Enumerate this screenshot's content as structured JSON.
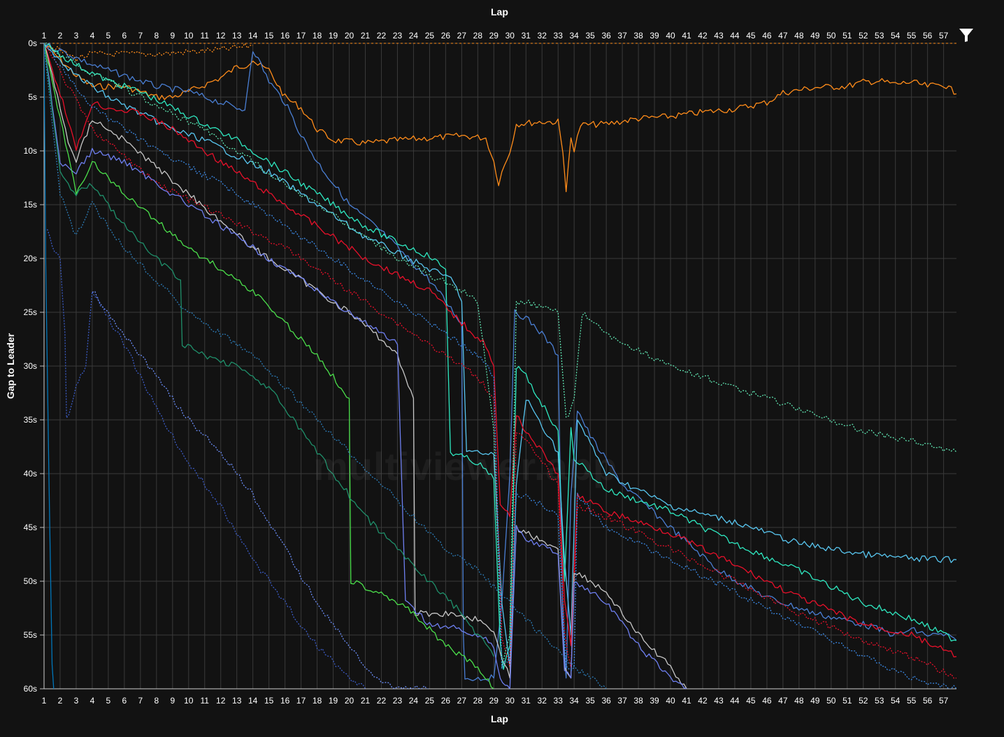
{
  "chart_data": {
    "type": "line",
    "xlabel": "Lap",
    "ylabel": "Gap to Leader",
    "x_ticks": [
      1,
      2,
      3,
      4,
      5,
      6,
      7,
      8,
      9,
      10,
      11,
      12,
      13,
      14,
      15,
      16,
      17,
      18,
      19,
      20,
      21,
      22,
      23,
      24,
      25,
      26,
      27,
      28,
      29,
      30,
      31,
      32,
      33,
      34,
      35,
      36,
      37,
      38,
      39,
      40,
      41,
      42,
      43,
      44,
      45,
      46,
      47,
      48,
      49,
      50,
      51,
      52,
      53,
      54,
      55,
      56,
      57
    ],
    "y_ticks": [
      "0s",
      "5s",
      "10s",
      "15s",
      "20s",
      "25s",
      "30s",
      "35s",
      "40s",
      "45s",
      "50s",
      "55s",
      "60s"
    ],
    "xlim": [
      1,
      57.8
    ],
    "ylim": [
      0,
      60
    ],
    "y_inverted": true,
    "grid": true,
    "watermark": "multiviewer.app",
    "series": [
      {
        "color": "#ff8c1a",
        "dashed": false,
        "x": [
          1,
          2,
          3,
          4,
          6,
          8,
          9,
          10,
          12,
          13,
          13.6,
          14,
          14.3,
          15,
          16,
          17,
          18,
          19,
          21,
          23,
          25,
          27,
          28.5,
          29,
          29.3,
          29.5,
          30,
          30.4,
          32,
          33,
          33.3,
          33.5,
          33.8,
          34,
          34.4,
          36,
          38,
          40,
          42,
          44,
          46,
          47,
          49,
          51,
          52,
          53,
          54,
          55,
          56,
          57,
          57.8
        ],
        "y": [
          0,
          1.5,
          3,
          4,
          4,
          5,
          5,
          4.5,
          3.2,
          2.2,
          2,
          1.5,
          2,
          2.5,
          5,
          6,
          8,
          9,
          9.3,
          9,
          8.8,
          8.6,
          8.8,
          11,
          13,
          12,
          10,
          7.5,
          7.3,
          7.3,
          10.2,
          13.8,
          8.5,
          10,
          7.6,
          7.5,
          7,
          6.8,
          6.4,
          6.1,
          5.5,
          4.6,
          4.1,
          4,
          3.6,
          3.5,
          3.8,
          3.6,
          4,
          3.8,
          4.7
        ]
      },
      {
        "color": "#ff8c1a",
        "dashed": true,
        "x": [
          1,
          3,
          4,
          6,
          8,
          10,
          12,
          14
        ],
        "y": [
          0,
          1.4,
          1,
          1,
          1,
          0.8,
          0.6,
          0.2
        ]
      },
      {
        "color": "#4a7fd4",
        "dashed": false,
        "x": [
          1,
          4,
          6,
          8,
          10,
          12,
          13.5,
          14,
          15,
          16,
          17,
          18,
          19,
          20,
          22,
          24,
          25,
          26,
          26.5,
          27,
          27.1,
          27.2,
          29,
          29.5,
          30,
          30.3,
          31,
          32,
          33,
          33.3,
          33.5,
          33.8,
          34.2,
          35,
          37,
          40,
          43,
          46,
          49,
          52,
          54,
          55,
          56,
          57,
          57.8
        ],
        "y": [
          0,
          2,
          3,
          4,
          4.5,
          5.5,
          6.2,
          0.5,
          3.5,
          5.5,
          8.5,
          11,
          13,
          15,
          17.5,
          20.5,
          22,
          24,
          25,
          26,
          55,
          59,
          59,
          52,
          40,
          25,
          25.5,
          27,
          29,
          54,
          59,
          42,
          34,
          36.5,
          41,
          45,
          49,
          51.5,
          53,
          54,
          55,
          54.5,
          55,
          55,
          55.5
        ]
      },
      {
        "color": "#2ee8c0",
        "dashed": false,
        "x": [
          1,
          3,
          5,
          7,
          9,
          11,
          13,
          15,
          17,
          19,
          21,
          23,
          25,
          26,
          26.3,
          28,
          29,
          29.4,
          29.6,
          30,
          30.4,
          31,
          33,
          33.4,
          33.8,
          34,
          36,
          40,
          44,
          48,
          52,
          55,
          57.8
        ],
        "y": [
          0,
          2,
          3.5,
          4.5,
          6,
          7.5,
          9,
          11,
          13,
          15,
          17,
          18.5,
          19.8,
          21,
          38,
          39,
          40.5,
          56,
          58,
          56,
          30,
          31,
          36,
          50,
          36,
          38.5,
          41.5,
          43.5,
          46.5,
          49,
          52,
          53.5,
          55.5
        ]
      },
      {
        "color": "#58c6f0",
        "dashed": false,
        "x": [
          1,
          3,
          5,
          7,
          9,
          11,
          13,
          15,
          17,
          19,
          21,
          23,
          25,
          26.5,
          27,
          27.3,
          29,
          29.5,
          30,
          30.4,
          31,
          33,
          33.4,
          33.8,
          34.2,
          36,
          40,
          44,
          48,
          52,
          55,
          57.8
        ],
        "y": [
          0,
          3,
          5,
          6.5,
          8,
          9,
          10.5,
          12,
          14,
          16,
          18,
          19.5,
          21,
          22,
          24,
          38,
          38.2,
          52,
          58,
          41,
          33,
          38,
          48,
          55,
          35,
          40,
          43,
          44.5,
          46.5,
          47.5,
          47.9,
          48
        ]
      },
      {
        "color": "#e8102a",
        "dashed": false,
        "x": [
          1,
          2.5,
          3,
          4,
          5,
          7,
          9,
          11,
          13,
          15,
          17,
          19,
          21,
          23,
          25,
          27,
          28.5,
          29,
          29.4,
          30,
          30.4,
          31,
          33,
          33.4,
          33.8,
          34.2,
          36,
          40,
          44,
          48,
          52,
          55,
          57.8
        ],
        "y": [
          0,
          7,
          10,
          5.5,
          6,
          6.5,
          8,
          10,
          12,
          14,
          16,
          18,
          20,
          21.5,
          23,
          26,
          28,
          30,
          43,
          44,
          34.5,
          36,
          40,
          52,
          56,
          42,
          43.5,
          45.5,
          48.5,
          51.5,
          54,
          55,
          57
        ]
      },
      {
        "color": "#e8102a",
        "dashed": true,
        "x": [
          1,
          4,
          8,
          12,
          16,
          20,
          24,
          28,
          29,
          29.5,
          30,
          30.4,
          31,
          33,
          33.4,
          33.8,
          34.2,
          36,
          40,
          44,
          48,
          52,
          55,
          57.8
        ],
        "y": [
          0,
          8,
          13,
          16,
          19,
          23,
          27,
          31,
          33,
          55,
          58,
          36,
          37,
          41,
          55,
          58,
          43,
          44,
          47,
          50,
          53,
          55.5,
          57,
          59
        ]
      },
      {
        "color": "#c8c8c8",
        "dashed": false,
        "x": [
          1,
          2.5,
          3,
          4,
          6,
          8,
          10,
          12,
          14,
          16,
          18,
          20,
          22,
          23,
          24,
          24.1,
          26,
          28,
          29,
          29.5,
          30,
          30.4,
          31,
          33,
          33.4,
          33.8,
          34,
          36,
          38,
          40,
          41
        ],
        "y": [
          0,
          9,
          11,
          7,
          9,
          11.5,
          14,
          16.5,
          19,
          21,
          23,
          25,
          27.5,
          29,
          33,
          53,
          53,
          53.5,
          55,
          57,
          59,
          45,
          45.5,
          47,
          58,
          59,
          49,
          51,
          55,
          58,
          60
        ]
      },
      {
        "color": "#6e7ff0",
        "dashed": false,
        "x": [
          1,
          2,
          3,
          4,
          6,
          8,
          10,
          12,
          14,
          16,
          18,
          20,
          22,
          23,
          23.5,
          25,
          27,
          28,
          29,
          29.4,
          30,
          30.4,
          31,
          33,
          33.4,
          33.8,
          34,
          36,
          38,
          40,
          41
        ],
        "y": [
          0,
          11,
          12,
          10,
          11,
          13,
          15,
          17,
          19,
          21,
          23,
          25,
          27,
          28,
          52,
          54,
          54.5,
          55,
          56,
          59,
          60,
          45,
          46,
          47.5,
          58,
          59,
          50,
          52,
          56,
          59,
          60
        ]
      },
      {
        "color": "#4be04b",
        "dashed": false,
        "x": [
          1,
          2,
          3,
          4,
          6,
          8,
          10,
          12,
          14,
          16,
          18,
          19,
          20,
          20.1,
          21,
          22,
          23,
          24,
          26,
          28,
          29
        ],
        "y": [
          0,
          7,
          14,
          11,
          14,
          16.5,
          19,
          21,
          23,
          26,
          29,
          31,
          33,
          50,
          50.5,
          51,
          52,
          53,
          56,
          58,
          60
        ]
      },
      {
        "color": "#1f8f6a",
        "dashed": false,
        "x": [
          1,
          2,
          3,
          4,
          6,
          8,
          9.5,
          9.6,
          11,
          13,
          15,
          17,
          19,
          21,
          23,
          25,
          27,
          29
        ],
        "y": [
          0,
          12,
          14,
          13,
          17,
          20,
          22,
          28,
          29,
          30,
          32,
          36,
          40,
          44,
          47,
          50,
          53,
          57
        ]
      },
      {
        "color": "#2b7ab5",
        "dashed": true,
        "x": [
          1,
          2,
          3,
          4,
          6,
          8,
          10,
          12,
          14,
          16,
          18,
          20,
          22,
          24,
          26,
          28,
          30,
          32,
          34,
          36
        ],
        "y": [
          0,
          14,
          18,
          15,
          19,
          22,
          25,
          27,
          29,
          32,
          35,
          38,
          41,
          44,
          47,
          49,
          52,
          55,
          58,
          60
        ]
      },
      {
        "color": "#3b5bc4",
        "dashed": true,
        "x": [
          1.2,
          1.5,
          2,
          2.3,
          2.4,
          3,
          3.3,
          3.6,
          4,
          6,
          8,
          10,
          12,
          14,
          16,
          18,
          20,
          21
        ],
        "y": [
          17,
          19,
          20,
          27,
          35,
          32,
          31,
          30,
          23,
          28,
          34,
          39,
          43,
          48,
          52,
          56,
          59,
          60
        ]
      },
      {
        "color": "#6a8cf5",
        "dashed": true,
        "x": [
          4,
          6,
          8,
          10,
          12,
          14,
          16,
          18,
          20,
          21.5,
          23,
          24,
          25
        ],
        "y": [
          23,
          27,
          31,
          35,
          38,
          42,
          47,
          52,
          56,
          59,
          60,
          60,
          60
        ]
      },
      {
        "color": "#5fe3b0",
        "dashed": true,
        "x": [
          1,
          3,
          5,
          7,
          9,
          11,
          13,
          15,
          17,
          19,
          21,
          23,
          25,
          27,
          28,
          29,
          29.5,
          30,
          30.4,
          31,
          33,
          33.5,
          34,
          34.5,
          36,
          40,
          44,
          48,
          52,
          55,
          57.8
        ],
        "y": [
          0,
          2,
          3.5,
          5,
          6.5,
          8,
          10,
          12,
          14,
          16,
          18,
          20,
          21.5,
          23,
          24,
          36,
          58,
          55,
          24,
          24,
          25,
          35,
          33,
          25,
          27,
          30,
          32,
          34,
          36,
          37,
          38
        ]
      },
      {
        "color": "#3a86e0",
        "dashed": true,
        "x": [
          1,
          4,
          8,
          12,
          16,
          20,
          24,
          28,
          29,
          29.5,
          30,
          30.4,
          31,
          33,
          33.5,
          34,
          34.2,
          36,
          40,
          44,
          48,
          52,
          55,
          57.8
        ],
        "y": [
          0,
          6,
          10,
          13,
          17,
          21,
          25,
          29,
          31,
          58,
          57,
          42,
          42,
          44,
          58,
          58,
          42,
          45,
          48,
          51,
          54,
          57,
          59,
          60
        ]
      },
      {
        "color": "#0077bb",
        "dashed": false,
        "x": [
          1,
          1.1,
          1.3,
          1.5,
          1.6
        ],
        "y": [
          0,
          20,
          40,
          58,
          60
        ]
      }
    ]
  },
  "labels": {
    "x_title": "Lap",
    "y_title": "Gap to Leader",
    "watermark": "multiviewer.app",
    "filter_icon": "filter-icon"
  }
}
